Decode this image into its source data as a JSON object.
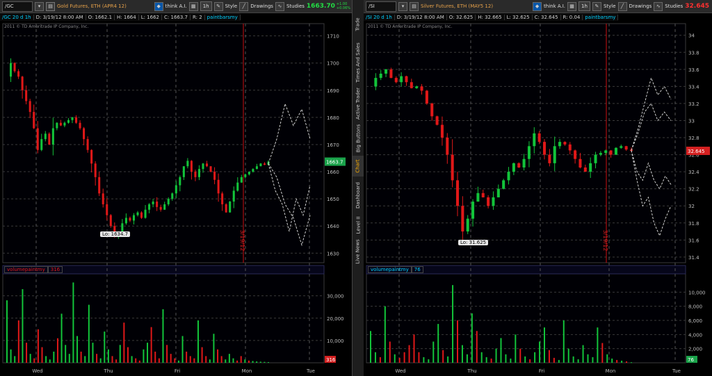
{
  "left": {
    "toolbar": {
      "symbol": "/GC",
      "description": "Gold Futures, ETH (APR4 12)",
      "think": "think A.I.",
      "interval": "1h",
      "style": "Style",
      "drawings": "Drawings",
      "studies": "Studies",
      "last": "1663.70",
      "change_line1": "+1.00",
      "change_line2": "+0.06%"
    },
    "info": {
      "sym": "/GC 20 d 1h",
      "date": "D: 3/19/12 8:00 AM",
      "open": "O: 1662.1",
      "high": "H: 1664",
      "low": "L: 1662",
      "close": "C: 1663.7",
      "range": "R: 2",
      "study": "paintbarsmy"
    },
    "copyright": "2011 © TD Ameritrade IP Company, Inc.",
    "low_label": "Lo: 1634.7",
    "price_tag": "1663.7",
    "volume_label": "volumepaintmy",
    "volume_value": "316",
    "volume_tag": "316",
    "date_marker": "3/19/12"
  },
  "right": {
    "toolbar": {
      "symbol": "/SI",
      "description": "Silver Futures, ETH (MAY5 12)",
      "think": "think A.I.",
      "interval": "1h",
      "style": "Style",
      "drawings": "Drawings",
      "studies": "Studies",
      "last": "32.645"
    },
    "info": {
      "sym": "/SI 20 d 1h",
      "date": "D: 3/19/12 8:00 AM",
      "open": "O: 32.625",
      "high": "H: 32.665",
      "low": "L: 32.625",
      "close": "C: 32.645",
      "range": "R: 0.04",
      "study": "paintbarsmy"
    },
    "copyright": "2011 © TD Ameritrade IP Company, Inc.",
    "low_label": "Lo: 31.625",
    "price_tag": "32.645",
    "volume_label": "volumepaintmy",
    "volume_value": "76",
    "volume_tag": "76",
    "date_marker": "3/19/12"
  },
  "sidebar": {
    "tabs": [
      "Trade",
      "Times And Sales",
      "Active Trader",
      "Big Buttons",
      "Chart",
      "Dashboard",
      "Level II",
      "Live News"
    ],
    "active": "Chart"
  },
  "colors": {
    "up": "#12c43a",
    "down": "#e01818",
    "grid": "#3a3a3a",
    "background": "#000000",
    "marker": "#cc1111",
    "projection": "#cfcfcf"
  },
  "chart_data": [
    {
      "type": "candlestick",
      "symbol": "/GC",
      "ylim": [
        1627,
        1714
      ],
      "y_ticks": [
        1630,
        1640,
        1650,
        1660,
        1670,
        1680,
        1690,
        1700,
        1710
      ],
      "x_labels": [
        "Wed",
        "Thu",
        "Fri",
        "Mon",
        "Tue"
      ],
      "price_path": [
        1695,
        1700,
        1697,
        1695,
        1690,
        1686,
        1682,
        1676,
        1668,
        1672,
        1674,
        1670,
        1676,
        1678,
        1677,
        1678,
        1679,
        1680,
        1678,
        1676,
        1672,
        1668,
        1663,
        1658,
        1652,
        1648,
        1644,
        1640,
        1636,
        1638,
        1641,
        1643,
        1642,
        1644,
        1645,
        1643,
        1646,
        1648,
        1649,
        1647,
        1646,
        1648,
        1650,
        1652,
        1655,
        1658,
        1662,
        1664,
        1660,
        1658,
        1661,
        1663,
        1662,
        1660,
        1657,
        1652,
        1648,
        1645,
        1649,
        1653,
        1656,
        1658,
        1659,
        1660,
        1661,
        1662,
        1663,
        1662.5,
        1663.7
      ],
      "low": 1634.7,
      "last": 1663.7,
      "projections": [
        [
          1663,
          1672,
          1685,
          1677,
          1683,
          1672
        ],
        [
          1663,
          1653,
          1648,
          1638,
          1650,
          1644,
          1655
        ],
        [
          1663,
          1658,
          1648,
          1643,
          1633,
          1644
        ]
      ],
      "volume": {
        "ylim": [
          0,
          38000
        ],
        "y_ticks": [
          10000,
          20000,
          30000
        ],
        "y_tick_labels": [
          "10,000",
          "20,000",
          "30,000"
        ],
        "values": [
          28000,
          6000,
          3000,
          19000,
          33000,
          9000,
          4000,
          2000,
          15000,
          7000,
          3000,
          1500,
          5000,
          11000,
          22000,
          8000,
          4000,
          36000,
          12000,
          5000,
          3000,
          26000,
          9000,
          4000,
          2000,
          14000,
          6000,
          3000,
          1500,
          8000,
          18000,
          7000,
          3000,
          2000,
          1000,
          6000,
          9000,
          16000,
          5000,
          2000,
          24000,
          8000,
          4000,
          2000,
          1000,
          12000,
          5000,
          3000,
          2000,
          19000,
          7000,
          3000,
          1500,
          13000,
          6000,
          3000,
          1500,
          4000,
          2000,
          1000,
          3000,
          1500,
          1000,
          800,
          600,
          500,
          400,
          316
        ]
      }
    },
    {
      "type": "candlestick",
      "symbol": "/SI",
      "ylim": [
        31.35,
        34.12
      ],
      "y_ticks": [
        31.4,
        31.6,
        31.8,
        32,
        32.2,
        32.4,
        32.6,
        32.8,
        33,
        33.2,
        33.4,
        33.6,
        33.8,
        34
      ],
      "x_labels": [
        "Wed",
        "Thu",
        "Fri",
        "Mon",
        "Tue"
      ],
      "price_path": [
        33.4,
        33.5,
        33.55,
        33.6,
        33.5,
        33.45,
        33.52,
        33.45,
        33.38,
        33.4,
        33.35,
        33.2,
        33.05,
        32.95,
        32.8,
        32.6,
        32.3,
        32.0,
        31.7,
        31.85,
        32.05,
        32.15,
        32.1,
        32.0,
        32.1,
        32.2,
        32.3,
        32.4,
        32.5,
        32.45,
        32.55,
        32.7,
        32.85,
        32.75,
        32.6,
        32.5,
        32.7,
        32.75,
        32.72,
        32.65,
        32.55,
        32.45,
        32.4,
        32.5,
        32.6,
        32.62,
        32.65,
        32.6,
        32.68,
        32.7,
        32.66,
        32.645
      ],
      "low": 31.625,
      "last": 32.645,
      "projections": [
        [
          32.65,
          32.9,
          33.2,
          33.5,
          33.3,
          33.4,
          33.25
        ],
        [
          32.65,
          32.85,
          33.1,
          33.2,
          33.0,
          33.1,
          33.0
        ],
        [
          32.65,
          32.4,
          32.3,
          32.5,
          32.3,
          32.2,
          32.35,
          32.25
        ],
        [
          32.65,
          32.3,
          32.0,
          32.1,
          31.8,
          31.65,
          31.85,
          32.0
        ]
      ],
      "volume": {
        "ylim": [
          0,
          12000
        ],
        "y_ticks": [
          2000,
          4000,
          6000,
          8000,
          10000
        ],
        "y_tick_labels": [
          "2,000",
          "4,000",
          "6,000",
          "8,000",
          "10,000"
        ],
        "values": [
          4500,
          1500,
          800,
          8000,
          3000,
          1200,
          700,
          1500,
          2500,
          4000,
          1500,
          800,
          500,
          3000,
          5500,
          1800,
          900,
          11000,
          6000,
          2500,
          1200,
          7000,
          4500,
          1500,
          800,
          600,
          2000,
          3500,
          1200,
          600,
          4000,
          2000,
          900,
          500,
          1500,
          3000,
          5000,
          1800,
          700,
          400,
          6000,
          2000,
          900,
          500,
          2500,
          1200,
          800,
          5000,
          2800,
          1200,
          600,
          400,
          300,
          200,
          76
        ]
      }
    }
  ]
}
